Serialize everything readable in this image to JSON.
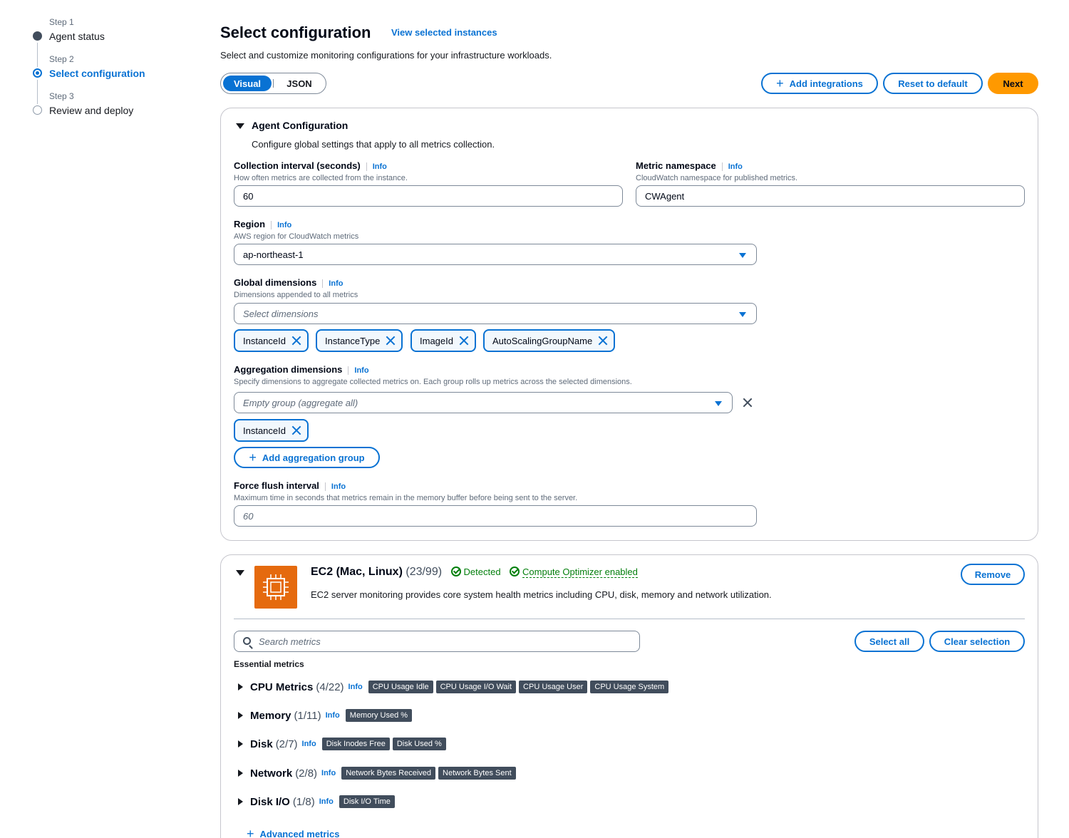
{
  "stepper": {
    "steps": [
      {
        "num": "Step 1",
        "title": "Agent status"
      },
      {
        "num": "Step 2",
        "title": "Select configuration"
      },
      {
        "num": "Step 3",
        "title": "Review and deploy"
      }
    ]
  },
  "header": {
    "title": "Select configuration",
    "view_link": "View selected instances",
    "description": "Select and customize monitoring configurations for your infrastructure workloads."
  },
  "mode_toggle": {
    "visual": "Visual",
    "json": "JSON",
    "selected": "Visual"
  },
  "actions": {
    "add_integrations": "Add integrations",
    "reset": "Reset to default",
    "next": "Next"
  },
  "agent_config": {
    "title": "Agent Configuration",
    "description": "Configure global settings that apply to all metrics collection.",
    "info": "Info",
    "collection_interval": {
      "label": "Collection interval (seconds)",
      "desc": "How often metrics are collected from the instance.",
      "value": "60"
    },
    "metric_namespace": {
      "label": "Metric namespace",
      "desc": "CloudWatch namespace for published metrics.",
      "value": "CWAgent"
    },
    "region": {
      "label": "Region",
      "desc": "AWS region for CloudWatch metrics",
      "value": "ap-northeast-1"
    },
    "global_dimensions": {
      "label": "Global dimensions",
      "desc": "Dimensions appended to all metrics",
      "placeholder": "Select dimensions",
      "tokens": [
        "InstanceId",
        "InstanceType",
        "ImageId",
        "AutoScalingGroupName"
      ]
    },
    "aggregation_dimensions": {
      "label": "Aggregation dimensions",
      "desc": "Specify dimensions to aggregate collected metrics on. Each group rolls up metrics across the selected dimensions.",
      "placeholder": "Empty group (aggregate all)",
      "tokens": [
        "InstanceId"
      ],
      "add_group": "Add aggregation group"
    },
    "force_flush": {
      "label": "Force flush interval",
      "desc": "Maximum time in seconds that metrics remain in the memory buffer before being sent to the server.",
      "placeholder": "60"
    }
  },
  "ec2": {
    "name": "EC2 (Mac, Linux)",
    "count": "(23/99)",
    "detected": "Detected",
    "optimizer": "Compute Optimizer enabled",
    "description": "EC2 server monitoring provides core system health metrics including CPU, disk, memory and network utilization.",
    "remove": "Remove",
    "search_placeholder": "Search metrics",
    "select_all": "Select all",
    "clear_selection": "Clear selection",
    "essential_label": "Essential metrics",
    "info": "Info",
    "groups": [
      {
        "name": "CPU Metrics",
        "count": "(4/22)",
        "badges": [
          "CPU Usage Idle",
          "CPU Usage I/O Wait",
          "CPU Usage User",
          "CPU Usage System"
        ]
      },
      {
        "name": "Memory",
        "count": "(1/11)",
        "badges": [
          "Memory Used %"
        ]
      },
      {
        "name": "Disk",
        "count": "(2/7)",
        "badges": [
          "Disk Inodes Free",
          "Disk Used %"
        ]
      },
      {
        "name": "Network",
        "count": "(2/8)",
        "badges": [
          "Network Bytes Received",
          "Network Bytes Sent"
        ]
      },
      {
        "name": "Disk I/O",
        "count": "(1/8)",
        "badges": [
          "Disk I/O Time"
        ]
      }
    ],
    "advanced": "Advanced metrics"
  },
  "colors": {
    "accent": "#0972d3",
    "primary_button": "#ff9900",
    "success": "#037f0c",
    "ec2_icon": "#e56a0e",
    "badge": "#414d5c"
  }
}
